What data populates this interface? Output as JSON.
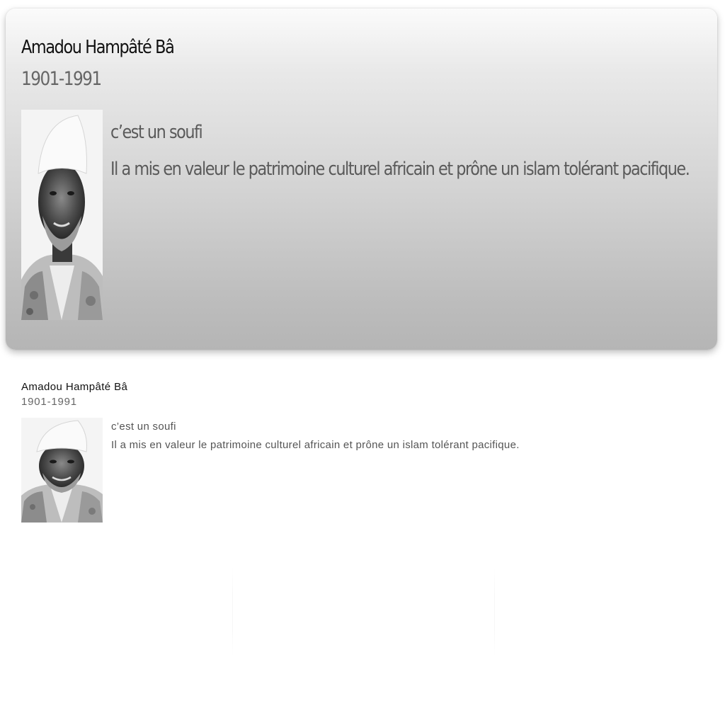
{
  "card_large": {
    "name": "Amadou Hampâté Bâ",
    "dates": "1901-1991",
    "tagline": "c’est un soufi",
    "description": "Il a mis en valeur le patrimoine culturel africain et prône un islam tolérant pacifique."
  },
  "card_small": {
    "name": "Amadou Hampâté Bâ",
    "dates": "1901-1991",
    "tagline": "c’est un soufi",
    "description": "Il a mis en valeur le patrimoine culturel africain et prône un islam tolérant pacifique."
  },
  "colors": {
    "title": "#111111",
    "dates": "#666666",
    "body": "#5a5a5a"
  }
}
